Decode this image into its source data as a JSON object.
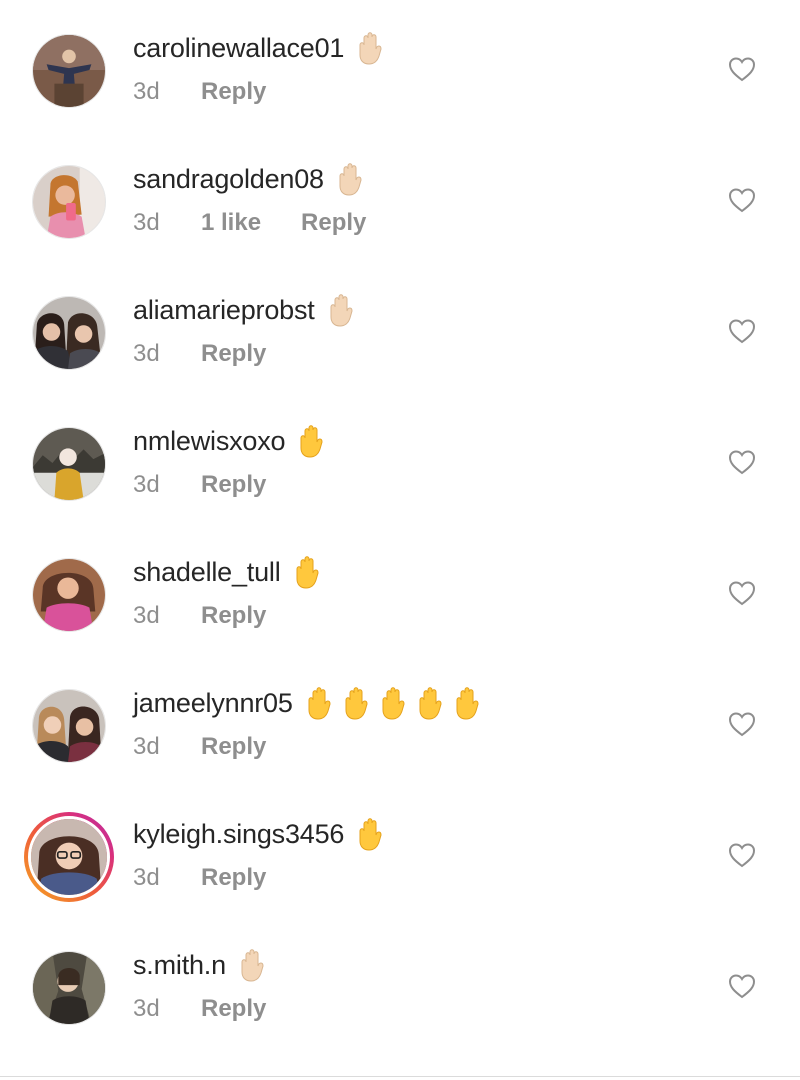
{
  "colors": {
    "username": "#262626",
    "meta": "#8e8e8e",
    "skin_light": "#f3d6b8",
    "skin_yellow": "#ffc83d",
    "story_ring": [
      "#f6a823",
      "#ee5a3c",
      "#d9307d",
      "#b52ea8"
    ]
  },
  "comments": [
    {
      "username": "carolinewallace01",
      "time": "3d",
      "likes": "",
      "reply": "Reply",
      "emoji": [
        "raised-hand-light-icon"
      ]
    },
    {
      "username": "sandragolden08",
      "time": "3d",
      "likes": "1 like",
      "reply": "Reply",
      "emoji": [
        "raised-hand-light-icon"
      ]
    },
    {
      "username": "aliamarieprobst",
      "time": "3d",
      "likes": "",
      "reply": "Reply",
      "emoji": [
        "raised-hand-light-icon"
      ]
    },
    {
      "username": "nmlewisxoxo",
      "time": "3d",
      "likes": "",
      "reply": "Reply",
      "emoji": [
        "raised-hand-yellow-icon"
      ]
    },
    {
      "username": "shadelle_tull",
      "time": "3d",
      "likes": "",
      "reply": "Reply",
      "emoji": [
        "raised-hand-yellow-icon"
      ]
    },
    {
      "username": "jameelynnr05",
      "time": "3d",
      "likes": "",
      "reply": "Reply",
      "emoji": [
        "raised-hand-yellow-icon",
        "raised-hand-yellow-icon",
        "raised-hand-yellow-icon",
        "raised-hand-yellow-icon",
        "raised-hand-yellow-icon"
      ]
    },
    {
      "username": "kyleigh.sings3456",
      "time": "3d",
      "likes": "",
      "reply": "Reply",
      "emoji": [
        "raised-hand-yellow-icon"
      ],
      "story_ring": true
    },
    {
      "username": "s.mith.n",
      "time": "3d",
      "likes": "",
      "reply": "Reply",
      "emoji": [
        "raised-hand-light-icon"
      ]
    }
  ]
}
